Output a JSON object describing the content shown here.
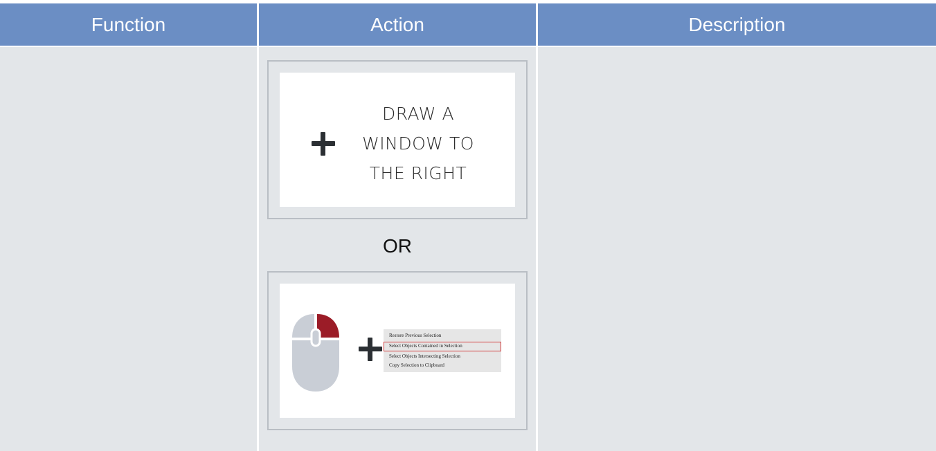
{
  "table": {
    "headers": [
      "Function",
      "Action",
      "Description"
    ]
  },
  "action": {
    "draw_window_text": "DRAW A WINDOW TO THE RIGHT",
    "separator": "OR",
    "context_menu": {
      "items": [
        "Restore Previous Selection",
        "Select Objects Contained in Selection",
        "Select Objects Intersecting Selection",
        "Copy Selection to Clipboard"
      ],
      "highlighted_item": "Select Objects Contained in Selection"
    },
    "icons": [
      "plus-icon",
      "mouse-right-click-icon"
    ]
  },
  "colors": {
    "header_bg": "#6b8ec4",
    "cell_bg": "#e3e6e9",
    "mouse_button_highlight": "#9b1c27",
    "menu_highlight_border": "#d23c3c"
  }
}
